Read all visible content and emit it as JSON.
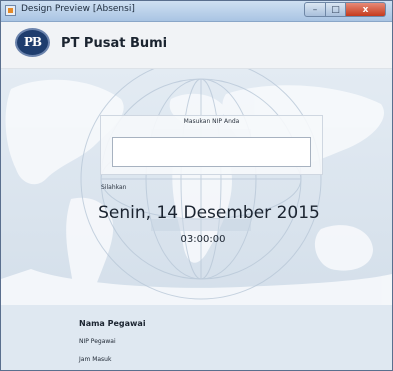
{
  "window": {
    "title": "Design Preview [Absensi]",
    "controls": {
      "minimize": "–",
      "maximize": "□",
      "close": "x"
    }
  },
  "header": {
    "logo_text": "PB",
    "company_name": "PT Pusat Bumi"
  },
  "form": {
    "prompt_label": "Masukan NIP Anda",
    "nip_value": "",
    "instruction": "Silahkan"
  },
  "clock": {
    "date": "Senin, 14 Desember 2015",
    "time": "03:00:00"
  },
  "employee": {
    "name_label": "Nama Pegawai",
    "nip_label": "NIP Pegawai",
    "check_in_label": "Jam Masuk"
  },
  "colors": {
    "titlebar": "#a9c4e3",
    "close_button": "#c53a1c",
    "logo": "#1e3d6e",
    "background": "#dfe8f1"
  }
}
